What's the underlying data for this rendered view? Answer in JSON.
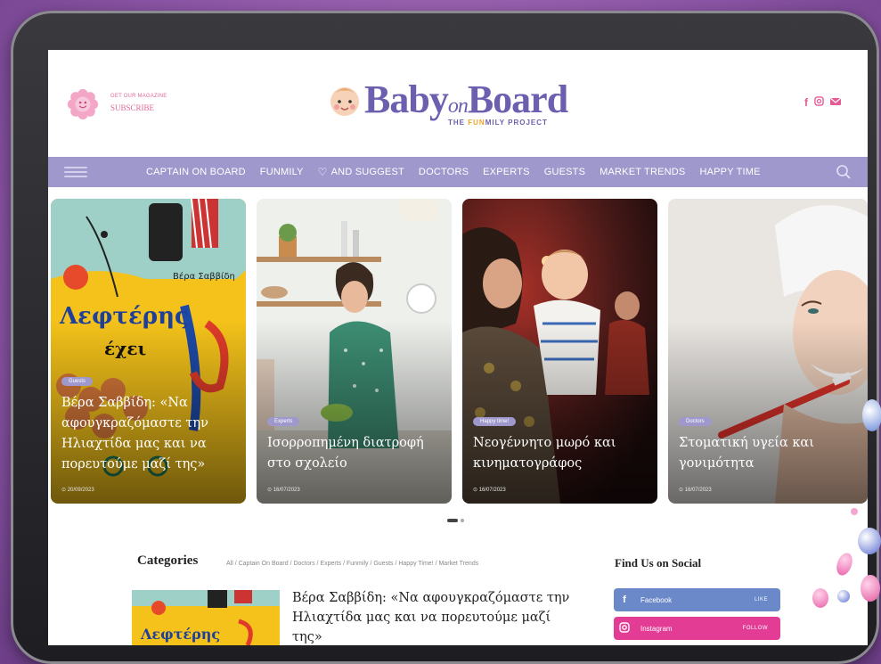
{
  "header": {
    "subscribe_small": "GET OUR MAGAZINE",
    "subscribe_label": "SUBSCRIBE",
    "logo_main": "Baby",
    "logo_on": "on",
    "logo_board": "Board",
    "logo_tag_pre": "THE ",
    "logo_tag_fun": "FUN",
    "logo_tag_post": "MILY PROJECT",
    "social_icons": [
      "facebook-icon",
      "instagram-icon",
      "mail-icon"
    ]
  },
  "nav": {
    "items": [
      "CAPTAIN ON BOARD",
      "FUNMILY",
      "AND SUGGEST",
      "DOCTORS",
      "EXPERTS",
      "GUESTS",
      "MARKET TRENDS",
      "HAPPY TIME"
    ]
  },
  "slider": {
    "cards": [
      {
        "badge": "Guests",
        "title": "Βέρα Σαββίδη: «Να αφουγκραζόμαστε την Ηλιαχτίδα μας και να πορευτούμε μαζί της»",
        "date": "⊙ 20/09/2023"
      },
      {
        "badge": "Experts",
        "title": "Ισορροπημένη διατροφή στο σχολείο",
        "date": "⊙ 16/07/2023"
      },
      {
        "badge": "Happy time!",
        "title": "Νεογέννητο μωρό και κινηματογράφος",
        "date": "⊙ 16/07/2023"
      },
      {
        "badge": "Doctors",
        "title": "Στοματική υγεία και γονιμότητα",
        "date": "⊙ 16/07/2023"
      }
    ]
  },
  "categories": {
    "title": "Categories",
    "list": "All / Captain On Board / Doctors / Experts / Funmily / Guests / Happy Time! / Market Trends"
  },
  "featured_post": {
    "title": "Βέρα Σαββίδη: «Να αφουγκραζόμαστε την Ηλιαχτίδα μας και να πορευτούμε μαζί της»"
  },
  "social": {
    "title": "Find Us on Social",
    "facebook": {
      "label": "Facebook",
      "action": "LIKE"
    },
    "instagram": {
      "label": "Instagram",
      "action": "FOLLOW"
    }
  },
  "colors": {
    "accent": "#9f98cd",
    "brand": "#6c5fb0",
    "pink": "#e45a94",
    "facebook": "#6b88c9",
    "instagram": "#e23c95"
  }
}
